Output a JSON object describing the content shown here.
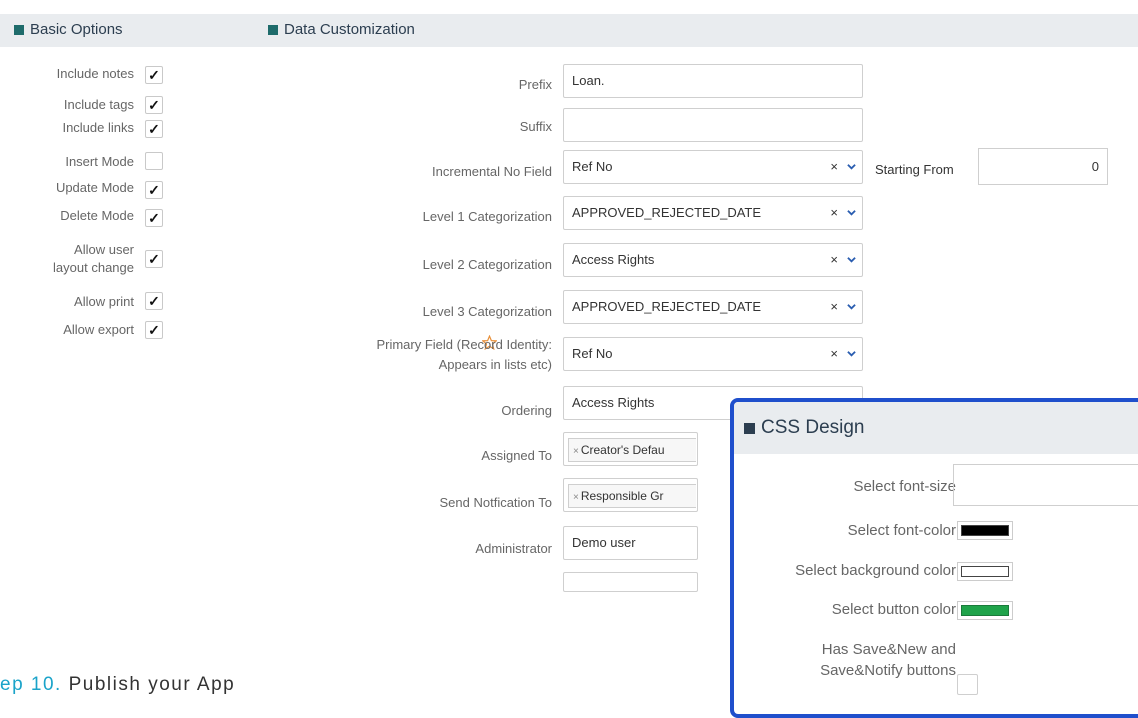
{
  "basic_options": {
    "title": "Basic Options",
    "items": [
      {
        "label": "Include notes",
        "checked": true
      },
      {
        "label": "Include tags",
        "checked": true
      },
      {
        "label": "Include links",
        "checked": true
      },
      {
        "label": "Insert Mode",
        "checked": false
      },
      {
        "label": "Update Mode",
        "checked": true
      },
      {
        "label": "Delete Mode",
        "checked": true
      },
      {
        "label_line1": "Allow user",
        "label_line2": "layout change",
        "checked": true
      },
      {
        "label": "Allow print",
        "checked": true
      },
      {
        "label": "Allow export",
        "checked": true
      }
    ],
    "check_glyph": "✓"
  },
  "data_customization": {
    "title": "Data Customization",
    "prefix": {
      "label": "Prefix",
      "value": "Loan."
    },
    "suffix": {
      "label": "Suffix",
      "value": ""
    },
    "incremental_no": {
      "label": "Incremental No Field",
      "value": "Ref No"
    },
    "starting_from": {
      "label": "Starting From",
      "value": "0"
    },
    "level1": {
      "label": "Level 1 Categorization",
      "value": "APPROVED_REJECTED_DATE"
    },
    "level2": {
      "label": "Level 2 Categorization",
      "value": "Access Rights"
    },
    "level3": {
      "label": "Level 3 Categorization",
      "value": "APPROVED_REJECTED_DATE"
    },
    "primary_field": {
      "label_line1": "Primary Field (Record Identity:",
      "label_line2": "Appears in lists etc)",
      "value": "Ref No"
    },
    "ordering": {
      "label": "Ordering",
      "value": "Access Rights"
    },
    "assigned_to": {
      "label": "Assigned To",
      "tag": "Creator's Defau"
    },
    "send_notification_to": {
      "label": "Send Notfication To",
      "tag": "Responsible Gr"
    },
    "administrator": {
      "label": "Administrator",
      "value": "Demo user"
    },
    "clear_glyph": "×",
    "tag_remove_glyph": "×"
  },
  "css_design": {
    "title": "CSS Design",
    "font_size": {
      "label": "Select font-size",
      "value": ""
    },
    "font_color": {
      "label": "Select font-color",
      "color": "#000000"
    },
    "background_color": {
      "label": "Select background color",
      "color": "#ffffff"
    },
    "button_color": {
      "label": "Select button color",
      "color": "#1fa34a"
    },
    "save_buttons": {
      "label_line1": "Has Save&New and",
      "label_line2": "Save&Notify buttons",
      "checked": false
    }
  },
  "step_caption": {
    "number": "ep 10.",
    "text": "Publish your App"
  },
  "colors": {
    "header_bg": "#e9ecef",
    "accent_square": "#1e6b6b",
    "panel_border": "#1f4fcc",
    "star": "#e8903a",
    "chevron": "#2a5db0",
    "step_number": "#1aa3c9"
  }
}
